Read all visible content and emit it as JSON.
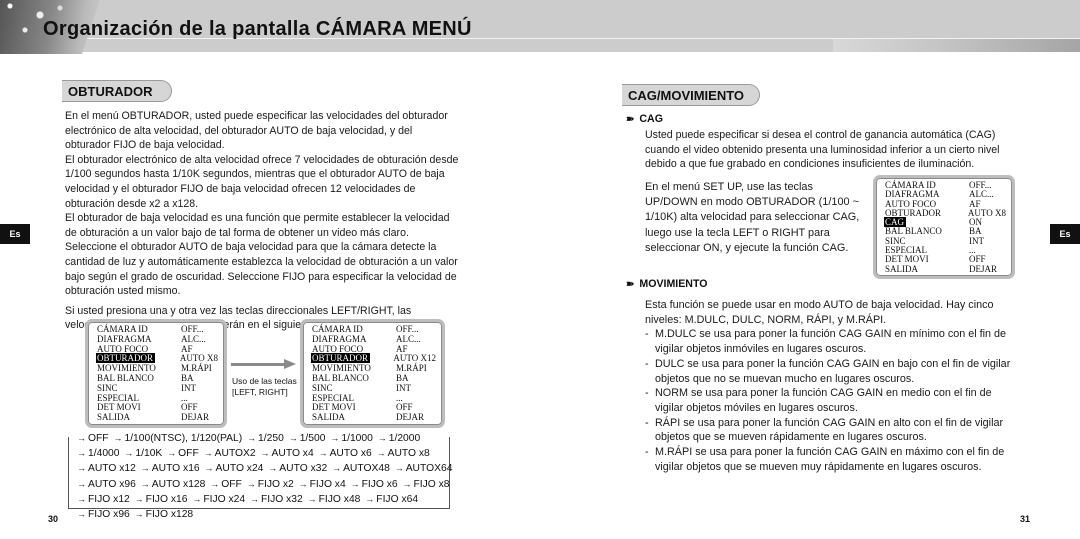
{
  "header": {
    "title": "Organización de la pantalla CÁMARA MENÚ"
  },
  "left_page": {
    "section_heading": "OBTURADOR",
    "paragraphs": [
      "En el menú OBTURADOR, usted puede especificar las velocidades del obturador electrónico de alta velocidad, del obturador AUTO de baja velocidad, y del obturador FIJO de baja velocidad.",
      "El obturador electrónico de alta velocidad ofrece 7 velocidades de obturación desde 1/100 segundos hasta 1/10K segundos, mientras que el obturador AUTO de baja velocidad y el obturador FIJO de baja velocidad ofrecen 12 velocidades de obturación desde x2 a x128.",
      "El obturador de baja velocidad es una función que permite establecer la velocidad de obturación a un valor bajo de tal forma de obtener un video más claro. Seleccione el obturador AUTO de baja velocidad para que la cámara detecte la cantidad de luz y automáticamente establezca la velocidad de obturación a un valor bajo según el grado de oscuridad. Seleccione FIJO para especificar la velocidad de obturación usted mismo.",
      "Si usted presiona una y otra vez las teclas direccionales LEFT/RIGHT, las velocidades de obturación aparecerán en el siguiente orden:"
    ],
    "menu_before": {
      "rows": [
        {
          "key": "CÁMARA ID",
          "value": "OFF..."
        },
        {
          "key": "DIAFRAGMA",
          "value": "ALC..."
        },
        {
          "key": "AUTO FOCO",
          "value": "AF"
        },
        {
          "key": "OBTURADOR",
          "value": "AUTO X8",
          "highlighted": true
        },
        {
          "key": "MOVIMIENTO",
          "value": "M.RÁPI"
        },
        {
          "key": "BAL BLANCO",
          "value": "BA"
        },
        {
          "key": "SINC",
          "value": "INT"
        },
        {
          "key": "ESPECIAL",
          "value": "..."
        },
        {
          "key": "DET MOVI",
          "value": "OFF"
        },
        {
          "key": "SALIDA",
          "value": "DEJAR"
        }
      ]
    },
    "arrow_caption_line1": "Uso de las teclas",
    "arrow_caption_line2": "[LEFT, RIGHT]",
    "menu_after": {
      "rows": [
        {
          "key": "CÁMARA ID",
          "value": "OFF..."
        },
        {
          "key": "DIAFRAGMA",
          "value": "ALC..."
        },
        {
          "key": "AUTO FOCO",
          "value": "AF"
        },
        {
          "key": "OBTURADOR",
          "value": "AUTO X12",
          "highlighted": true
        },
        {
          "key": "MOVIMIENTO",
          "value": "M.RÁPI"
        },
        {
          "key": "BAL BLANCO",
          "value": "BA"
        },
        {
          "key": "SINC",
          "value": "INT"
        },
        {
          "key": "ESPECIAL",
          "value": "..."
        },
        {
          "key": "DET MOVI",
          "value": "OFF"
        },
        {
          "key": "SALIDA",
          "value": "DEJAR"
        }
      ]
    },
    "speed_sequence": [
      "OFF",
      "1/100(NTSC), 1/120(PAL)",
      "1/250",
      "1/500",
      "1/1000",
      "1/2000",
      "1/4000",
      "1/10K",
      "OFF",
      "AUTOX2",
      "AUTO x4",
      "AUTO x6",
      "AUTO x8",
      "AUTO x12",
      "AUTO x16",
      "AUTO x24",
      "AUTO x32",
      "AUTOX48",
      "AUTOX64",
      "AUTO x96",
      "AUTO x128",
      "OFF",
      "FIJO x2",
      "FIJO x4",
      "FIJO x6",
      "FIJO x8",
      "FIJO x12",
      "FIJO x16",
      "FIJO x24",
      "FIJO x32",
      "FIJO x48",
      "FIJO x64",
      "FIJO x96",
      "FIJO x128"
    ],
    "lang_tab": "Es",
    "page_number": "30"
  },
  "right_page": {
    "section_heading": "CAG/MOVIMIENTO",
    "cag": {
      "heading": "CAG",
      "paragraph": "Usted puede especificar si desea el control de ganancia automática (CAG) cuando el video obtenido presenta una luminosidad inferior a un cierto nivel debido a que fue grabado en condiciones insuficientes de iluminación.",
      "instructions": "En el menú SET UP, use las teclas UP/DOWN en modo OBTURADOR (1/100 ~ 1/10K) alta velocidad para seleccionar CAG, luego use la tecla LEFT o RIGHT para seleccionar ON, y ejecute la función CAG.",
      "menu": {
        "rows": [
          {
            "key": "CÁMARA ID",
            "value": "OFF..."
          },
          {
            "key": "DIAFRAGMA",
            "value": "ALC..."
          },
          {
            "key": "AUTO FOCO",
            "value": "AF"
          },
          {
            "key": "OBTURADOR",
            "value": "AUTO X8"
          },
          {
            "key": "CAG",
            "value": "ON",
            "highlighted": true
          },
          {
            "key": "BAL BLANCO",
            "value": "BA"
          },
          {
            "key": "SINC",
            "value": "INT"
          },
          {
            "key": "ESPECIAL",
            "value": "..."
          },
          {
            "key": "DET MOVI",
            "value": "OFF"
          },
          {
            "key": "SALIDA",
            "value": "DEJAR"
          }
        ]
      }
    },
    "movimiento": {
      "heading": "MOVIMIENTO",
      "intro": "Esta función se puede usar en modo AUTO de baja velocidad. Hay cinco niveles: M.DULC, DULC, NORM, RÁPI, y M.RÁPI.",
      "items": [
        "M.DULC se usa para poner la función CAG GAIN en mínimo con el fin de vigilar objetos inmóviles en lugares oscuros.",
        "DULC se usa para poner la función CAG GAIN en bajo con el fin de vigilar objetos que no se muevan mucho en lugares oscuros.",
        "NORM se usa para poner la función CAG GAIN en medio con el fin de vigilar objetos móviles en lugares oscuros.",
        "RÁPI se usa para poner la función CAG GAIN en alto con el fin de vigilar objetos que se mueven rápidamente en lugares oscuros.",
        "M.RÁPI se usa para poner la función CAG GAIN en máximo con el fin de vigilar objetos que se mueven muy rápidamente en lugares oscuros."
      ]
    },
    "lang_tab": "Es",
    "page_number": "31"
  },
  "icons": {
    "sequence_arrow": "→",
    "subsection_bullet": "➽"
  }
}
